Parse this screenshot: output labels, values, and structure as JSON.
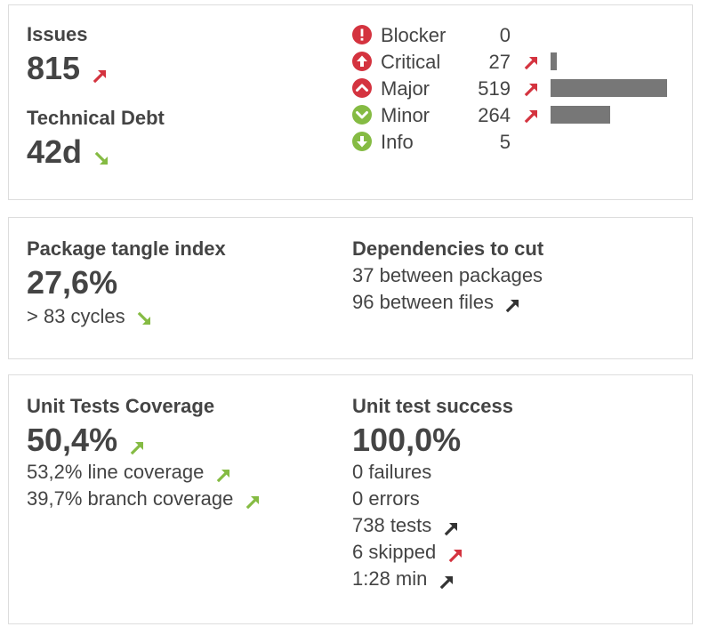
{
  "issues": {
    "label": "Issues",
    "count": "815",
    "trend": "up-red",
    "severities": [
      {
        "name": "Blocker",
        "count": "0",
        "icon": "blocker-icon",
        "color": "#d4333f",
        "trend": "none",
        "bar_fraction": 0.0
      },
      {
        "name": "Critical",
        "count": "27",
        "icon": "critical-icon",
        "color": "#d4333f",
        "trend": "up-red",
        "bar_fraction": 0.052
      },
      {
        "name": "Major",
        "count": "519",
        "icon": "major-icon",
        "color": "#d4333f",
        "trend": "up-red",
        "bar_fraction": 1.0
      },
      {
        "name": "Minor",
        "count": "264",
        "icon": "minor-icon",
        "color": "#85bb43",
        "trend": "up-red",
        "bar_fraction": 0.509
      },
      {
        "name": "Info",
        "count": "5",
        "icon": "info-icon",
        "color": "#85bb43",
        "trend": "none",
        "bar_fraction": 0.0
      }
    ]
  },
  "debt": {
    "label": "Technical Debt",
    "value": "42d",
    "trend": "down-green"
  },
  "design": {
    "tangle_label": "Package tangle index",
    "tangle_value": "27,6%",
    "cycles": "> 83 cycles",
    "cycles_trend": "down-green",
    "deps_label": "Dependencies to cut",
    "deps_packages": "37 between packages",
    "deps_files": "96 between files",
    "deps_files_trend": "up-dark"
  },
  "coverage": {
    "label": "Unit Tests Coverage",
    "value": "50,4%",
    "trend": "up-green",
    "line_coverage": "53,2% line coverage",
    "line_trend": "up-green",
    "branch_coverage": "39,7% branch coverage",
    "branch_trend": "up-green"
  },
  "success": {
    "label": "Unit test success",
    "value": "100,0%",
    "failures": "0 failures",
    "errors": "0 errors",
    "tests": "738 tests",
    "tests_trend": "up-dark",
    "skipped": "6 skipped",
    "skipped_trend": "up-red",
    "duration": "1:28 min",
    "duration_trend": "up-dark"
  },
  "colors": {
    "red": "#d4333f",
    "green": "#85bb43",
    "dark": "#333333",
    "bar": "#777777",
    "text": "#444444"
  }
}
